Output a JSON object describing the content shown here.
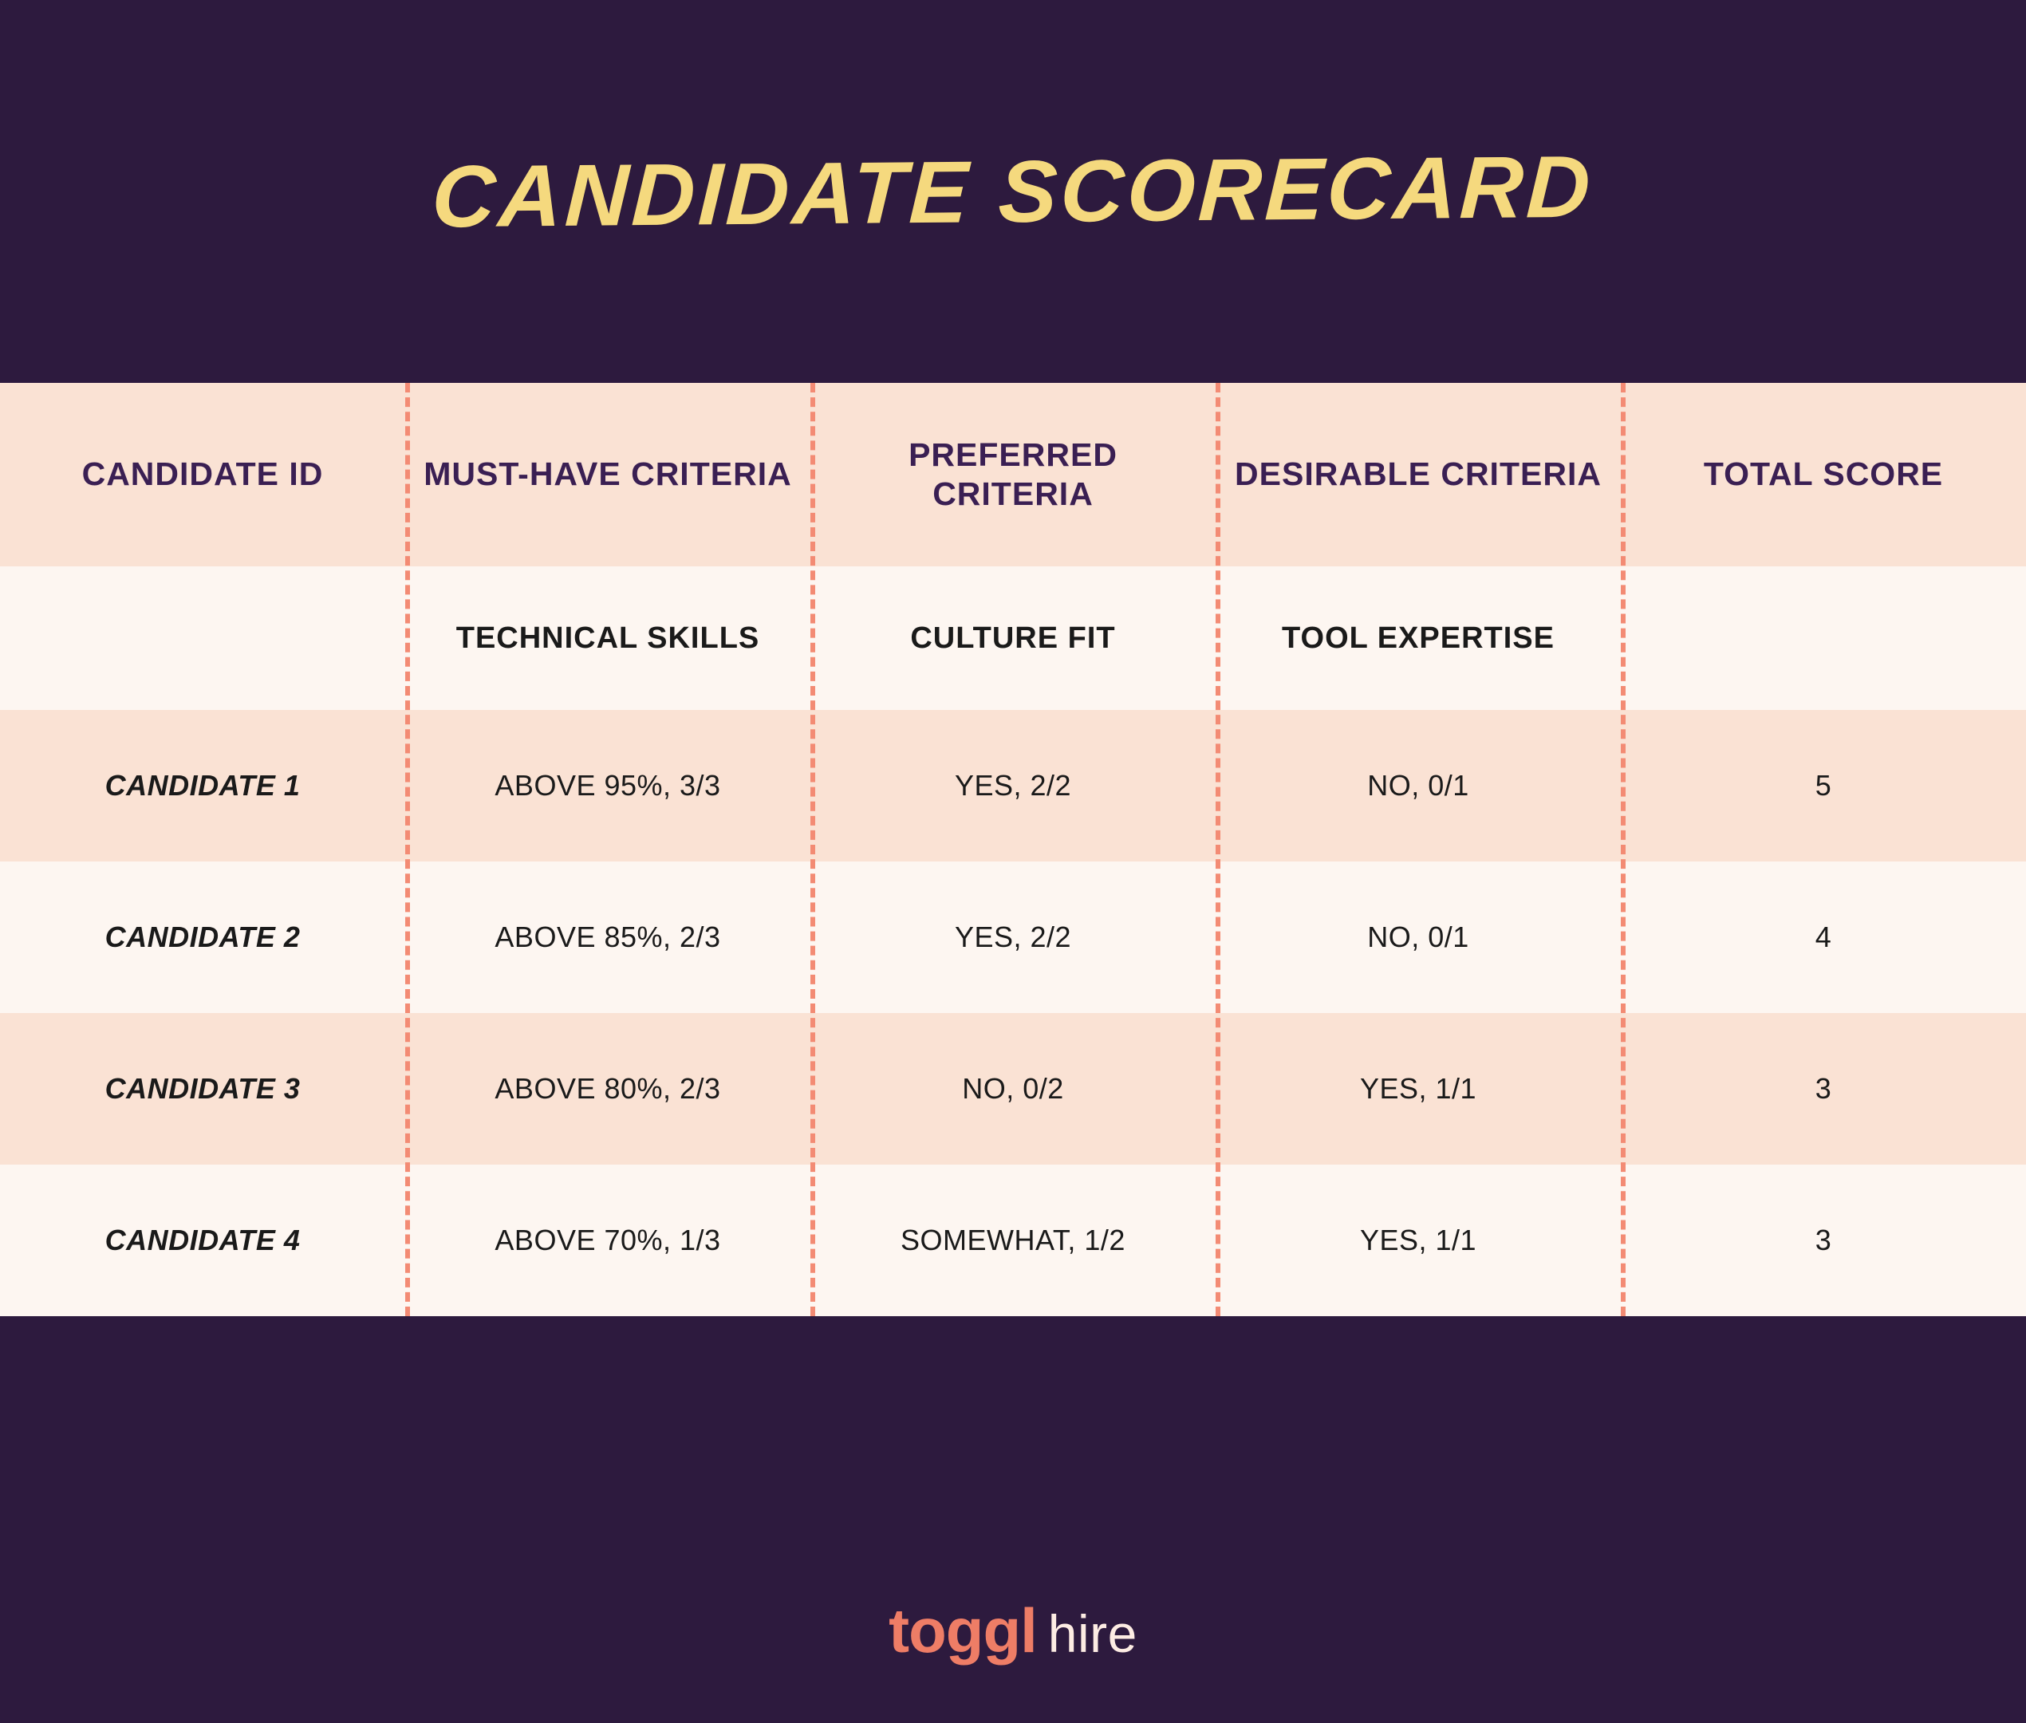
{
  "title": "Candidate Scorecard",
  "headers": {
    "candidate_id": "Candidate ID",
    "must_have": "Must-Have Criteria",
    "preferred": "Preferred Criteria",
    "desirable": "Desirable Criteria",
    "total": "Total Score"
  },
  "subheaders": {
    "candidate_id": "",
    "must_have": "Technical Skills",
    "preferred": "Culture Fit",
    "desirable": "Tool Expertise",
    "total": ""
  },
  "rows": [
    {
      "id": "Candidate 1",
      "must_have": "Above 95%, 3/3",
      "preferred": "Yes, 2/2",
      "desirable": "No, 0/1",
      "total": "5"
    },
    {
      "id": "Candidate 2",
      "must_have": "Above 85%, 2/3",
      "preferred": "Yes, 2/2",
      "desirable": "No, 0/1",
      "total": "4"
    },
    {
      "id": "Candidate 3",
      "must_have": "Above 80%, 2/3",
      "preferred": "No, 0/2",
      "desirable": "Yes, 1/1",
      "total": "3"
    },
    {
      "id": "Candidate 4",
      "must_have": "Above 70%, 1/3",
      "preferred": "Somewhat, 1/2",
      "desirable": "Yes, 1/1",
      "total": "3"
    }
  ],
  "logo": {
    "brand": "toggl",
    "product": "hire"
  },
  "chart_data": {
    "type": "table",
    "title": "Candidate Scorecard",
    "columns": [
      "Candidate ID",
      "Must-Have Criteria (Technical Skills)",
      "Preferred Criteria (Culture Fit)",
      "Desirable Criteria (Tool Expertise)",
      "Total Score"
    ],
    "rows": [
      [
        "Candidate 1",
        "Above 95%, 3/3",
        "Yes, 2/2",
        "No, 0/1",
        5
      ],
      [
        "Candidate 2",
        "Above 85%, 2/3",
        "Yes, 2/2",
        "No, 0/1",
        4
      ],
      [
        "Candidate 3",
        "Above 80%, 2/3",
        "No, 0/2",
        "Yes, 1/1",
        3
      ],
      [
        "Candidate 4",
        "Above 70%, 1/3",
        "Somewhat, 1/2",
        "Yes, 1/1",
        3
      ]
    ]
  }
}
